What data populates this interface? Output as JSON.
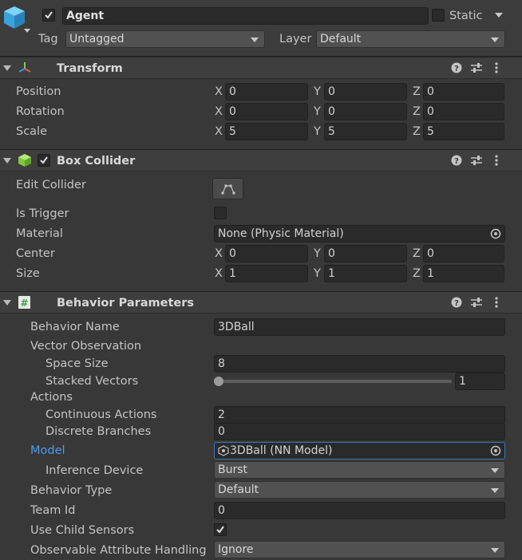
{
  "gameobject": {
    "name": "Agent",
    "active": true,
    "static_label": "Static",
    "static_checked": false,
    "tag_label": "Tag",
    "tag_value": "Untagged",
    "layer_label": "Layer",
    "layer_value": "Default"
  },
  "transform": {
    "title": "Transform",
    "rows": [
      {
        "label": "Position",
        "x": "0",
        "y": "0",
        "z": "0"
      },
      {
        "label": "Rotation",
        "x": "0",
        "y": "0",
        "z": "0"
      },
      {
        "label": "Scale",
        "x": "5",
        "y": "5",
        "z": "5"
      }
    ]
  },
  "axes": {
    "x": "X",
    "y": "Y",
    "z": "Z"
  },
  "box_collider": {
    "title": "Box Collider",
    "enabled": true,
    "edit_collider_label": "Edit Collider",
    "is_trigger_label": "Is Trigger",
    "is_trigger": false,
    "material_label": "Material",
    "material_value": "None (Physic Material)",
    "center": {
      "label": "Center",
      "x": "0",
      "y": "0",
      "z": "0"
    },
    "size": {
      "label": "Size",
      "x": "1",
      "y": "1",
      "z": "1"
    }
  },
  "behavior_parameters": {
    "title": "Behavior Parameters",
    "behavior_name_label": "Behavior Name",
    "behavior_name_value": "3DBall",
    "vector_observation_label": "Vector Observation",
    "space_size_label": "Space Size",
    "space_size_value": "8",
    "stacked_vectors_label": "Stacked Vectors",
    "stacked_vectors_value": "1",
    "stacked_vectors_fraction": 0.0,
    "actions_label": "Actions",
    "continuous_actions_label": "Continuous Actions",
    "continuous_actions_value": "2",
    "discrete_branches_label": "Discrete Branches",
    "discrete_branches_value": "0",
    "model_label": "Model",
    "model_value": "3DBall (NN Model)",
    "inference_device_label": "Inference Device",
    "inference_device_value": "Burst",
    "behavior_type_label": "Behavior Type",
    "behavior_type_value": "Default",
    "team_id_label": "Team Id",
    "team_id_value": "0",
    "use_child_sensors_label": "Use Child Sensors",
    "use_child_sensors": true,
    "observable_label": "Observable Attribute Handling",
    "observable_value": "Ignore"
  },
  "colors": {
    "model_label": "#4d9ce8",
    "focus_border": "#3a79bb",
    "background": "#383838"
  }
}
